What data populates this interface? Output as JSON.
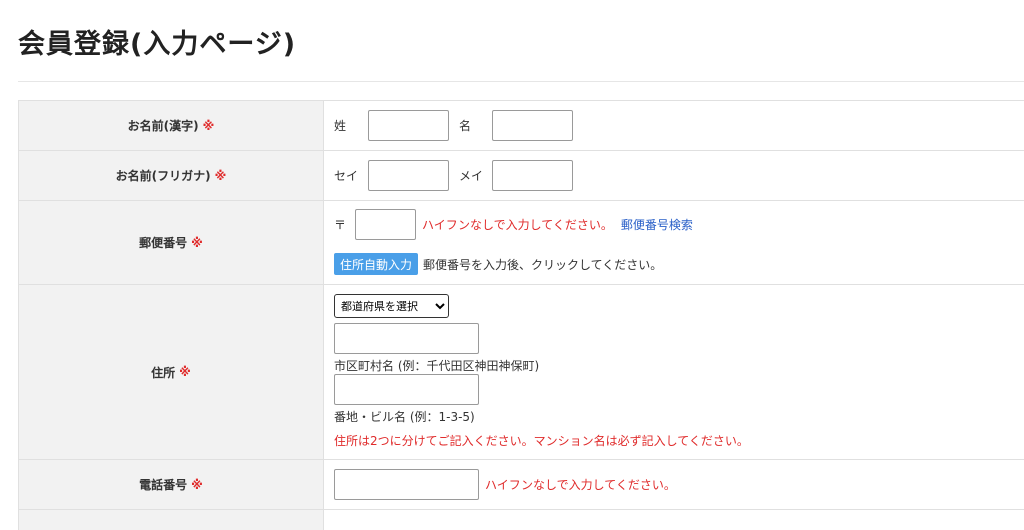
{
  "page": {
    "title": "会員登録(入力ページ)"
  },
  "required_mark": "※",
  "fields": {
    "name_kanji": {
      "label": "お名前(漢字)",
      "sei_label": "姓",
      "sei_value": "",
      "mei_label": "名",
      "mei_value": ""
    },
    "name_kana": {
      "label": "お名前(フリガナ)",
      "sei_label": "セイ",
      "sei_value": "",
      "mei_label": "メイ",
      "mei_value": ""
    },
    "postal": {
      "label": "郵便番号",
      "prefix": "〒",
      "value": "",
      "hint": "ハイフンなしで入力してください。",
      "search_link": "郵便番号検索",
      "auto_button": "住所自動入力",
      "auto_hint": "郵便番号を入力後、クリックしてください。"
    },
    "address": {
      "label": "住所",
      "prefecture_selected": "都道府県を選択",
      "city_value": "",
      "city_hint": "市区町村名 (例：千代田区神田神保町)",
      "street_value": "",
      "street_hint": "番地・ビル名 (例：1-3-5)",
      "note": "住所は2つに分けてご記入ください。マンション名は必ず記入してください。"
    },
    "phone": {
      "label": "電話番号",
      "value": "",
      "hint": "ハイフンなしで入力してください。"
    }
  }
}
